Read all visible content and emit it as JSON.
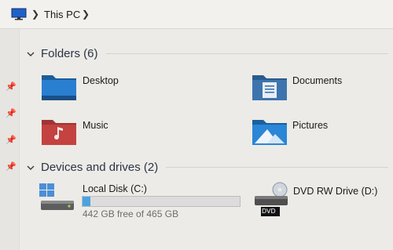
{
  "address": {
    "location": "This PC"
  },
  "folders": {
    "header": "Folders (6)",
    "items": [
      {
        "label": "Desktop",
        "icon": "desktop-folder-icon"
      },
      {
        "label": "Documents",
        "icon": "documents-folder-icon"
      },
      {
        "label": "Music",
        "icon": "music-folder-icon"
      },
      {
        "label": "Pictures",
        "icon": "pictures-folder-icon"
      }
    ]
  },
  "devices": {
    "header": "Devices and drives (2)",
    "drives": [
      {
        "label": "Local Disk (C:)",
        "free_text": "442 GB free of 465 GB",
        "used_fraction": 0.05,
        "icon": "hard-disk-icon"
      },
      {
        "label": "DVD RW Drive (D:)",
        "badge": "DVD",
        "icon": "dvd-drive-icon"
      }
    ]
  },
  "colors": {
    "accent": "#4aa3e0",
    "folder_blue": "#1f6fb3",
    "music_red": "#c4423f"
  }
}
